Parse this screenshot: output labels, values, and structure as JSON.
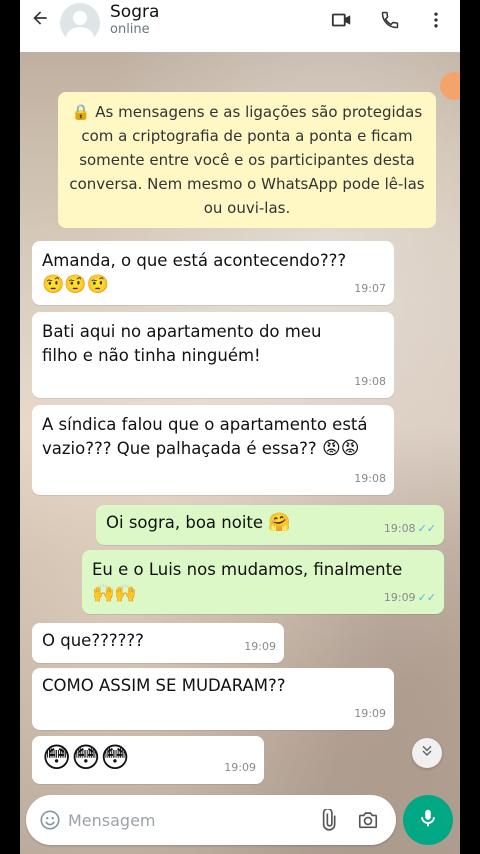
{
  "header": {
    "contact_name": "Sogra",
    "status": "online"
  },
  "icons": {
    "back": "back-arrow-icon",
    "video": "video-call-icon",
    "phone": "phone-icon",
    "menu": "more-vert-icon",
    "emoji": "emoji-icon",
    "attach": "paperclip-icon",
    "camera": "camera-icon",
    "mic": "microphone-icon",
    "scroll": "chevron-down-double-icon"
  },
  "encryption_notice": "🔒 As mensagens e as ligações são protegidas com a criptografia de ponta a ponta e ficam somente entre você e os participantes desta conversa. Nem mesmo o WhatsApp pode lê-las ou ouvi-las.",
  "messages": [
    {
      "direction": "in",
      "text": "Amanda, o que está acontecendo???",
      "emoji": "🤨🤨🤨",
      "time": "19:07"
    },
    {
      "direction": "in",
      "text": "Bati aqui no apartamento do meu filho e não tinha ninguém!",
      "time": "19:08"
    },
    {
      "direction": "in",
      "text": "A síndica falou que o apartamento está vazio??? Que palhaçada é essa??",
      "emoji": "😡😡",
      "time": "19:08"
    },
    {
      "direction": "out",
      "text": "Oi sogra, boa noite",
      "emoji": "🤗",
      "time": "19:08",
      "read": "✓✓"
    },
    {
      "direction": "out",
      "text": "Eu e o Luis nos mudamos, finalmente",
      "emoji": "🙌🙌",
      "time": "19:09",
      "read": "✓✓"
    },
    {
      "direction": "in",
      "text": "O que??????",
      "time": "19:09"
    },
    {
      "direction": "in",
      "text": "COMO ASSIM SE MUDARAM??",
      "time": "19:09"
    },
    {
      "direction": "in",
      "text": "😳😳😳",
      "time": "19:09"
    }
  ],
  "compose": {
    "placeholder": "Mensagem"
  },
  "colors": {
    "incoming": "#ffffff",
    "outgoing": "#dcf8c6",
    "notice": "#fff7c4",
    "accent": "#00a884",
    "read_ticks": "#4fb6ec"
  }
}
